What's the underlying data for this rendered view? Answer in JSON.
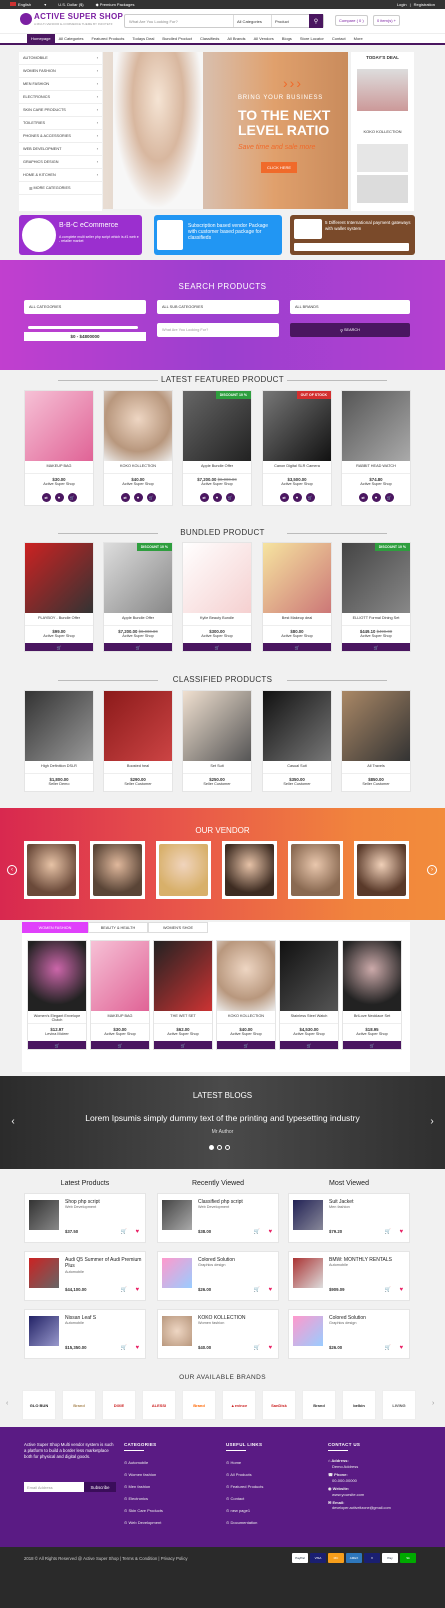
{
  "topbar": {
    "language": "English",
    "currency": "U.S. Dollar ($)",
    "packages": "Premium Packages",
    "login": "Login",
    "separator": "|",
    "register": "Registration"
  },
  "header": {
    "logo": "ACTIVE SUPER SHOP",
    "tagline": "A MULTI-VENDOR E-COMMERCE THEME BY INFOTETZ",
    "search_placeholder": "What Are You Looking For?",
    "category_select": "All Categories",
    "type_select": "Product",
    "compare": "Compare ( 0 )",
    "cart": "0 item(s) +"
  },
  "nav": [
    "Homepage",
    "All Categories",
    "Featured Products",
    "Todays Deal",
    "Bundled Product",
    "Classifieds",
    "All Brands",
    "All Vendors",
    "Blogs",
    "Store Locator",
    "Contact",
    "More"
  ],
  "categories": [
    "AUTOMOBILE",
    "WOMEN FASHION",
    "MEN FASHION",
    "ELECTRONICS",
    "SKIN CARE PRODUCTS",
    "TOILETRIES",
    "PHONES & ACCESSORIES",
    "WEB DEVELOPMENT",
    "GRAPHICS DESIGN",
    "HOME & KITCHEN",
    "MORE CATEGORIES"
  ],
  "banner": {
    "arrows": "›››",
    "line1": "BRING YOUR BUSINESS",
    "line2": "TO THE NEXT LEVEL RATIO",
    "line3": "Save time and sale more",
    "cta": "CLICK HERE"
  },
  "todays_deal": {
    "title": "TODAY'S DEAL",
    "item": "KOKO KOLLECTION"
  },
  "promos": {
    "b2b_title": "B-B-C eCommerce",
    "b2b_text": "A complete multi seller php script which is #1 web e - retailer market",
    "sub_text": "Subscription based vendor Package with customer based package for classifieds",
    "pay_text": "5 Different International payment gateways with wallet system"
  },
  "search_section": {
    "title": "SEARCH PRODUCTS",
    "cat": "ALL CATEGORIES",
    "subcat": "ALL SUB CATEGORIES",
    "brands": "ALL BRANDS",
    "range": "$0 - $4800000",
    "placeholder": "What Are You Looking For?",
    "button": "SEARCH"
  },
  "featured": {
    "title": "LATEST FEATURED PRODUCT",
    "items": [
      {
        "name": "MAKEUP BAG",
        "price": "$30.00",
        "old": "",
        "seller": "Active Super Shop",
        "badge": ""
      },
      {
        "name": "KOKO KOLLECTION",
        "price": "$40.00",
        "old": "",
        "seller": "Active Super Shop",
        "badge": ""
      },
      {
        "name": "Apple Bundle Offer",
        "price": "$7,200.00",
        "old": "$8,000.00",
        "seller": "Active Super Shop",
        "badge": "DISCOUNT 10 %"
      },
      {
        "name": "Canon Digital SLR Camera",
        "price": "$3,500.00",
        "old": "",
        "seller": "Active Super Shop",
        "badge": "OUT OF STOCK"
      },
      {
        "name": "RABBIT HEAD WATCH",
        "price": "$74.80",
        "old": "",
        "seller": "Active Super Shop",
        "badge": ""
      }
    ]
  },
  "bundled": {
    "title": "BUNDLED PRODUCT",
    "items": [
      {
        "name": "PLAYBOY - Bundle Offer",
        "price": "$99.00",
        "old": "",
        "seller": "Active Super Shop",
        "badge": ""
      },
      {
        "name": "Apple Bundle Offer",
        "price": "$7,200.00",
        "old": "$8,000.00",
        "seller": "Active Super Shop",
        "badge": "DISCOUNT 10 %"
      },
      {
        "name": "Kylie Beauty Bundle",
        "price": "$300.00",
        "old": "",
        "seller": "Active Super Shop",
        "badge": ""
      },
      {
        "name": "Best Makeup deal",
        "price": "$80.00",
        "old": "",
        "seller": "Active Super Shop",
        "badge": ""
      },
      {
        "name": "ELLIOTT Formal Dining Set",
        "price": "$449.10",
        "old": "$499.00",
        "seller": "Active Super Shop",
        "badge": "DISCOUNT 10 %"
      }
    ]
  },
  "classified": {
    "title": "CLASSIFIED PRODUCTS",
    "items": [
      {
        "name": "High Definition DSLR",
        "price": "$1,800.00",
        "seller": "Seller Demo"
      },
      {
        "name": "Boosted heal",
        "price": "$290.00",
        "seller": "Seller Customer"
      },
      {
        "name": "Set Suit",
        "price": "$250.00",
        "seller": "Seller Customer"
      },
      {
        "name": "Casual Suit",
        "price": "$350.00",
        "seller": "Seller Customer"
      },
      {
        "name": "All Travels",
        "price": "$850.00",
        "seller": "Seller Customer"
      }
    ]
  },
  "vendor": {
    "title": "OUR VENDOR"
  },
  "tabs": {
    "labels": [
      "WOMEN FASHION",
      "BEAUTY & HEALTH",
      "WOMEN'S SHOE"
    ],
    "items": [
      {
        "name": "Women's Elegant Envelope Clutch",
        "price": "$12.97",
        "seller": "Levina Mcleer"
      },
      {
        "name": "MAKEUP BAG",
        "price": "$30.00",
        "seller": "Active Super Shop"
      },
      {
        "name": "THE WET SET",
        "price": "$62.00",
        "seller": "Active Super Shop"
      },
      {
        "name": "KOKO KOLLECTION",
        "price": "$40.00",
        "seller": "Active Super Shop"
      },
      {
        "name": "Stainless Steel Watch",
        "price": "$4,530.00",
        "seller": "Active Super Shop"
      },
      {
        "name": "BriLove Necklace Set",
        "price": "$18.95",
        "seller": "Active Super Shop"
      }
    ]
  },
  "blogs": {
    "title": "LATEST BLOGS",
    "text": "Lorem Ipsumis simply dummy text of the printing and typesetting industry",
    "author": "Mr Author"
  },
  "lists": [
    {
      "title": "Latest Products",
      "items": [
        {
          "name": "Shop php script",
          "cat": "Web Development",
          "price": "$37.50"
        },
        {
          "name": "Audi Q5 Summer of Audi Premium Plus",
          "cat": "Automobile",
          "price": "$44,100.00"
        },
        {
          "name": "Nissan Leaf S",
          "cat": "Automobile",
          "price": "$15,350.00"
        }
      ]
    },
    {
      "title": "Recently Viewed",
      "items": [
        {
          "name": "Classified php script",
          "cat": "Web Development",
          "price": "$38.00"
        },
        {
          "name": "Colored Solution",
          "cat": "Graphics design",
          "price": "$26.00"
        },
        {
          "name": "KOKO KOLLECTION",
          "cat": "Women fashion",
          "price": "$40.00"
        }
      ]
    },
    {
      "title": "Most Viewed",
      "items": [
        {
          "name": "Suit Jacket",
          "cat": "Men fashion",
          "price": "$79.20"
        },
        {
          "name": "BMW: MONTHLY RENTALS",
          "cat": "Automobile",
          "price": "$909.09"
        },
        {
          "name": "Colored Solution",
          "cat": "Graphics design",
          "price": "$26.00"
        }
      ]
    }
  ],
  "brands": {
    "title": "OUR AVAILABLE BRANDS",
    "items": [
      "GLO BUN",
      "Brand",
      "DIXIE",
      "ALESSI",
      "Brand",
      "▲evince",
      "SanDisk",
      "Brand",
      "belkin",
      "LIVING"
    ]
  },
  "footer": {
    "about": "Active Super Shop Multi vendor system is such a platform to build a border less marketplace both for physical and digital goods.",
    "email_placeholder": "Email Address",
    "subscribe": "Subscribe",
    "categories_title": "CATEGORIES",
    "categories": [
      "Automobile",
      "Women fashion",
      "Men fashion",
      "Electronics",
      "Skin Care Products",
      "Web Development"
    ],
    "links_title": "USEFUL LINKS",
    "links": [
      "Home",
      "All Products",
      "Featured Products",
      "Contact",
      "new page1",
      "Documentation"
    ],
    "contact_title": "CONTACT US",
    "address_label": "Address:",
    "address": "Demo Address",
    "phone_label": "Phone:",
    "phone": "00-000-00000",
    "website_label": "Website:",
    "website": "www.yoursite.com",
    "email_label": "Email:",
    "email": "developer.activeitzone@gmail.com"
  },
  "copyright": "2018 © All Rights Reserved @ Active Super Shop | Terms & Condition | Privacy Policy",
  "payments": [
    "PayPal",
    "VISA",
    "MC",
    "AMEX",
    "V",
    "Pay",
    "Sk"
  ]
}
